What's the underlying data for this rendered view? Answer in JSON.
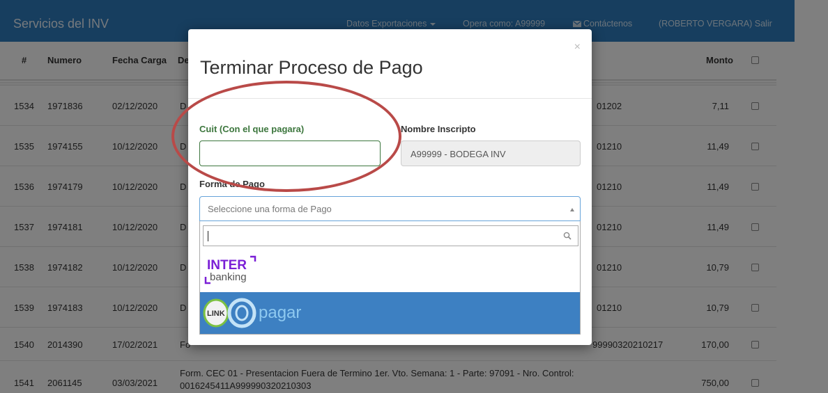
{
  "navbar": {
    "brand": "Servicios del INV",
    "links": [
      {
        "label": "Datos Exportaciones",
        "has_caret": true
      },
      {
        "label": "Opera como: A99999",
        "has_caret": false
      },
      {
        "label": "Contáctenos",
        "icon": "envelope-icon"
      },
      {
        "label": "(ROBERTO VERGARA) Salir"
      }
    ]
  },
  "table": {
    "headers": {
      "num": "#",
      "numero": "Numero",
      "fecha": "Fecha Carga",
      "desc": "De",
      "monto": "Monto"
    },
    "rows": [
      {
        "num": "",
        "numero": "",
        "fecha": "",
        "desc": "",
        "tail": "",
        "monto": ""
      },
      {
        "num": "1534",
        "numero": "1971836",
        "fecha": "02/12/2020",
        "desc": "D",
        "tail": "01202",
        "monto": "7,11"
      },
      {
        "num": "1535",
        "numero": "1974155",
        "fecha": "10/12/2020",
        "desc": "D",
        "tail": "01210",
        "monto": "11,49"
      },
      {
        "num": "1536",
        "numero": "1974179",
        "fecha": "10/12/2020",
        "desc": "D",
        "tail": "01210",
        "monto": "11,49"
      },
      {
        "num": "1537",
        "numero": "1974181",
        "fecha": "10/12/2020",
        "desc": "D",
        "tail": "01210",
        "monto": "11,49"
      },
      {
        "num": "1538",
        "numero": "1974182",
        "fecha": "10/12/2020",
        "desc": "D",
        "tail": "01210",
        "monto": "10,79"
      },
      {
        "num": "1539",
        "numero": "1974183",
        "fecha": "10/12/2020",
        "desc": "D",
        "tail": "01210",
        "monto": "10,79"
      },
      {
        "num": "1540",
        "numero": "2014390",
        "fecha": "17/02/2021",
        "desc": "Fo",
        "tail": "99990320210217",
        "monto": "170,00"
      },
      {
        "num": "1541",
        "numero": "2061145",
        "fecha": "03/03/2021",
        "desc": "Form. CEC 01 - Presentacion Fuera de Termino 1er. Vto. Semana: 1 - Parte: 97091 - Nro. Control:",
        "desc2": "0016245411A999990320210303",
        "tail": "",
        "monto": "750,00"
      }
    ]
  },
  "modal": {
    "title": "Terminar Proceso de Pago",
    "close": "×",
    "cuit_label": "Cuit (Con el que pagara)",
    "cuit_value": "",
    "nombre_label": "Nombre Inscripto",
    "nombre_value": "A99999 - BODEGA INV",
    "forma_label": "Forma de Pago",
    "select_placeholder": "Seleccione una forma de Pago",
    "search_value": "",
    "options": [
      {
        "logo_text_1": "INTER",
        "logo_text_2": "banking",
        "selected": false
      },
      {
        "logo_text_1": "LINK",
        "logo_text_2": "pagar",
        "selected": true
      }
    ]
  },
  "colors": {
    "navbar": "#2f7dbe",
    "success_green": "#3c763d",
    "highlight_blue": "#3d80c2",
    "interbanking_purple": "#7a1fd6",
    "link_green": "#7cc142",
    "annotation_red": "#b94a48"
  }
}
